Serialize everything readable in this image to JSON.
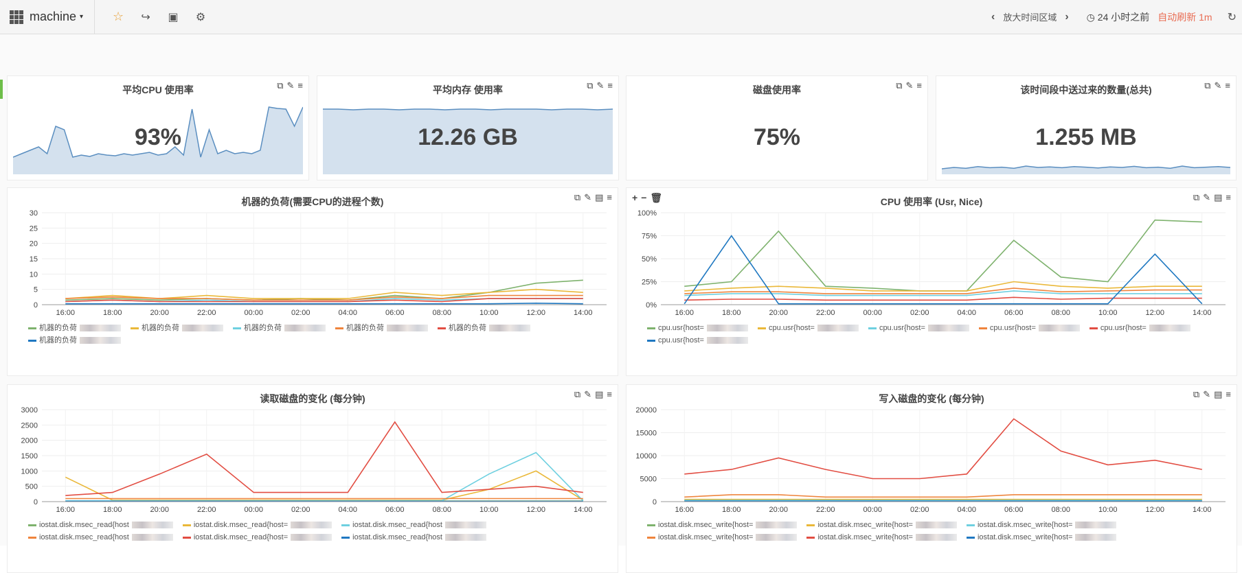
{
  "topbar": {
    "title": "machine",
    "zoom_label": "放大时间区域",
    "time_range": "24 小时之前",
    "auto_refresh": "自动刷新 1m"
  },
  "panels": {
    "avg_cpu": {
      "title": "平均CPU 使用率",
      "value": "93%"
    },
    "avg_mem": {
      "title": "平均内存 使用率",
      "value": "12.26 GB"
    },
    "disk_usage": {
      "title": "磁盘使用率",
      "value": "75%"
    },
    "sent_count": {
      "title": "该时间段中送过来的数量(总共)",
      "value": "1.255 MB"
    }
  },
  "chart_data": [
    {
      "type": "line",
      "title": "机器的负荷(需要CPU的进程个数)",
      "x": [
        "16:00",
        "18:00",
        "20:00",
        "22:00",
        "00:00",
        "02:00",
        "04:00",
        "06:00",
        "08:00",
        "10:00",
        "12:00",
        "14:00"
      ],
      "ylim": [
        0,
        30
      ],
      "yticks": [
        "0",
        "5",
        "10",
        "15",
        "20",
        "25",
        "30"
      ],
      "series": [
        {
          "name": "机器的负荷",
          "color": "#7eb26d",
          "values": [
            1.5,
            2,
            1.5,
            2,
            1.5,
            2,
            1.5,
            3,
            2,
            4,
            7,
            8
          ]
        },
        {
          "name": "机器的负荷",
          "color": "#eab839",
          "values": [
            2,
            3,
            2,
            3,
            2,
            2,
            2,
            4,
            3,
            4,
            5,
            4
          ]
        },
        {
          "name": "机器的负荷",
          "color": "#6ed0e0",
          "values": [
            1,
            1.5,
            1,
            1.5,
            1,
            1,
            1,
            2,
            1.5,
            2,
            2,
            2
          ]
        },
        {
          "name": "机器的负荷",
          "color": "#ef843c",
          "values": [
            2,
            2.5,
            2,
            2,
            1.5,
            1.5,
            1.5,
            2.5,
            2,
            3,
            3,
            3
          ]
        },
        {
          "name": "机器的负荷",
          "color": "#e24d42",
          "values": [
            1,
            1.5,
            1,
            1,
            1,
            1,
            1,
            1.5,
            1,
            2,
            2,
            2
          ]
        },
        {
          "name": "机器的负荷",
          "color": "#1f78c1",
          "values": [
            0.3,
            0.3,
            0.3,
            0.3,
            0.3,
            0.3,
            0.3,
            0.3,
            0.3,
            0.3,
            0.5,
            0.3
          ]
        }
      ]
    },
    {
      "type": "line",
      "title": "CPU 使用率 (Usr, Nice)",
      "x": [
        "16:00",
        "18:00",
        "20:00",
        "22:00",
        "00:00",
        "02:00",
        "04:00",
        "06:00",
        "08:00",
        "10:00",
        "12:00",
        "14:00"
      ],
      "ylim": [
        0,
        100
      ],
      "yticks": [
        "0%",
        "25%",
        "50%",
        "75%",
        "100%"
      ],
      "series": [
        {
          "name": "cpu.usr{host=",
          "color": "#7eb26d",
          "values": [
            20,
            25,
            80,
            20,
            18,
            15,
            15,
            70,
            30,
            25,
            92,
            90
          ]
        },
        {
          "name": "cpu.usr{host=",
          "color": "#eab839",
          "values": [
            15,
            18,
            20,
            18,
            15,
            15,
            15,
            25,
            20,
            18,
            20,
            20
          ]
        },
        {
          "name": "cpu.usr{host=",
          "color": "#6ed0e0",
          "values": [
            10,
            12,
            12,
            10,
            10,
            10,
            10,
            15,
            12,
            12,
            12,
            12
          ]
        },
        {
          "name": "cpu.usr{host=",
          "color": "#ef843c",
          "values": [
            12,
            14,
            14,
            12,
            12,
            12,
            12,
            18,
            14,
            15,
            16,
            16
          ]
        },
        {
          "name": "cpu.usr{host=",
          "color": "#e24d42",
          "values": [
            5,
            6,
            6,
            5,
            5,
            5,
            5,
            8,
            6,
            7,
            7,
            7
          ]
        },
        {
          "name": "cpu.usr{host=",
          "color": "#1f78c1",
          "values": [
            1,
            75,
            1,
            1,
            1,
            1,
            1,
            1,
            1,
            1,
            55,
            1
          ]
        }
      ]
    },
    {
      "type": "line",
      "title": "读取磁盘的变化 (每分钟)",
      "x": [
        "16:00",
        "18:00",
        "20:00",
        "22:00",
        "00:00",
        "02:00",
        "04:00",
        "06:00",
        "08:00",
        "10:00",
        "12:00",
        "14:00"
      ],
      "ylim": [
        0,
        3000
      ],
      "yticks": [
        "0",
        "500",
        "1000",
        "1500",
        "2000",
        "2500",
        "3000"
      ],
      "series": [
        {
          "name": "iostat.disk.msec_read{host",
          "color": "#7eb26d",
          "values": [
            20,
            20,
            20,
            20,
            20,
            20,
            20,
            20,
            20,
            20,
            20,
            20
          ]
        },
        {
          "name": "iostat.disk.msec_read{host=",
          "color": "#eab839",
          "values": [
            800,
            50,
            50,
            50,
            50,
            50,
            50,
            50,
            50,
            400,
            1000,
            50
          ]
        },
        {
          "name": "iostat.disk.msec_read{host",
          "color": "#6ed0e0",
          "values": [
            30,
            30,
            30,
            30,
            30,
            30,
            30,
            30,
            30,
            900,
            1600,
            30
          ]
        },
        {
          "name": "iostat.disk.msec_read{host",
          "color": "#ef843c",
          "values": [
            100,
            100,
            100,
            100,
            100,
            100,
            100,
            100,
            100,
            100,
            100,
            100
          ]
        },
        {
          "name": "iostat.disk.msec_read{host=",
          "color": "#e24d42",
          "values": [
            200,
            300,
            900,
            1550,
            300,
            300,
            300,
            2600,
            300,
            400,
            500,
            300
          ]
        },
        {
          "name": "iostat.disk.msec_read{host",
          "color": "#1f78c1",
          "values": [
            10,
            10,
            10,
            10,
            10,
            10,
            10,
            10,
            10,
            10,
            10,
            10
          ]
        }
      ]
    },
    {
      "type": "line",
      "title": "写入磁盘的变化 (每分钟)",
      "x": [
        "16:00",
        "18:00",
        "20:00",
        "22:00",
        "00:00",
        "02:00",
        "04:00",
        "06:00",
        "08:00",
        "10:00",
        "12:00",
        "14:00"
      ],
      "ylim": [
        0,
        20000
      ],
      "yticks": [
        "0",
        "5000",
        "10000",
        "15000",
        "20000"
      ],
      "series": [
        {
          "name": "iostat.disk.msec_write{host=",
          "color": "#7eb26d",
          "values": [
            200,
            200,
            200,
            200,
            200,
            200,
            200,
            200,
            200,
            200,
            200,
            200
          ]
        },
        {
          "name": "iostat.disk.msec_write{host=",
          "color": "#eab839",
          "values": [
            500,
            500,
            500,
            500,
            500,
            500,
            500,
            500,
            500,
            500,
            500,
            500
          ]
        },
        {
          "name": "iostat.disk.msec_write{host=",
          "color": "#6ed0e0",
          "values": [
            300,
            300,
            300,
            300,
            300,
            300,
            300,
            300,
            300,
            300,
            300,
            300
          ]
        },
        {
          "name": "iostat.disk.msec_write{host=",
          "color": "#ef843c",
          "values": [
            1000,
            1500,
            1500,
            1000,
            1000,
            1000,
            1000,
            1500,
            1500,
            1500,
            1500,
            1500
          ]
        },
        {
          "name": "iostat.disk.msec_write{host=",
          "color": "#e24d42",
          "values": [
            6000,
            7000,
            9500,
            7000,
            5000,
            5000,
            6000,
            18000,
            11000,
            8000,
            9000,
            7000
          ]
        },
        {
          "name": "iostat.disk.msec_write{host=",
          "color": "#1f78c1",
          "values": [
            100,
            100,
            100,
            100,
            100,
            100,
            100,
            100,
            100,
            100,
            100,
            100
          ]
        }
      ]
    }
  ],
  "spark_data": {
    "avg_cpu": [
      25,
      30,
      35,
      40,
      30,
      70,
      65,
      25,
      28,
      26,
      30,
      28,
      27,
      30,
      28,
      30,
      32,
      28,
      30,
      40,
      28,
      95,
      25,
      65,
      30,
      35,
      30,
      32,
      30,
      35,
      98,
      96,
      95,
      70,
      98
    ],
    "avg_mem": [
      95,
      95,
      94,
      95,
      95,
      94,
      95,
      95,
      94,
      95,
      95,
      94,
      95,
      95,
      95,
      94,
      95,
      95,
      94,
      95
    ],
    "sent_count": [
      20,
      25,
      22,
      28,
      24,
      26,
      22,
      30,
      25,
      27,
      24,
      28,
      26,
      23,
      27,
      25,
      29,
      24,
      26,
      22,
      30,
      24,
      26,
      28,
      25
    ]
  }
}
